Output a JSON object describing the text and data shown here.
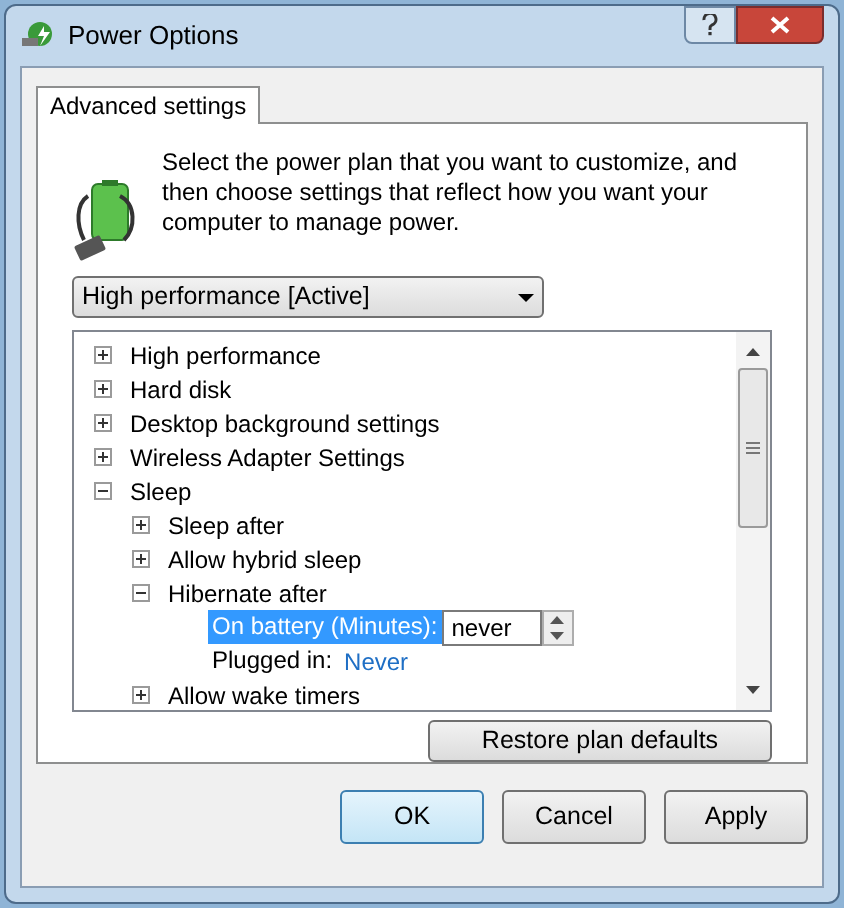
{
  "window": {
    "title": "Power Options"
  },
  "tabs": [
    {
      "label": "Advanced settings",
      "selected": true
    }
  ],
  "description": "Select the power plan that you want to customize, and then choose settings that reflect how you want your computer to manage power.",
  "plan_dropdown": {
    "value": "High performance [Active]"
  },
  "tree": [
    {
      "label": "High performance",
      "expanded": false
    },
    {
      "label": "Hard disk",
      "expanded": false
    },
    {
      "label": "Desktop background settings",
      "expanded": false
    },
    {
      "label": "Wireless Adapter Settings",
      "expanded": false
    },
    {
      "label": "Sleep",
      "expanded": true,
      "children": [
        {
          "label": "Sleep after",
          "expanded": false
        },
        {
          "label": "Allow hybrid sleep",
          "expanded": false
        },
        {
          "label": "Hibernate after",
          "expanded": true,
          "settings": [
            {
              "kind": "spin",
              "label": "On battery (Minutes):",
              "value": "never",
              "selected": true
            },
            {
              "kind": "link",
              "label": "Plugged in:",
              "value": "Never",
              "selected": false
            }
          ]
        },
        {
          "label": "Allow wake timers",
          "expanded": false
        }
      ]
    }
  ],
  "restore_button": "Restore plan defaults",
  "buttons": [
    {
      "label": "OK",
      "default": true
    },
    {
      "label": "Cancel",
      "default": false
    },
    {
      "label": "Apply",
      "default": false
    }
  ]
}
